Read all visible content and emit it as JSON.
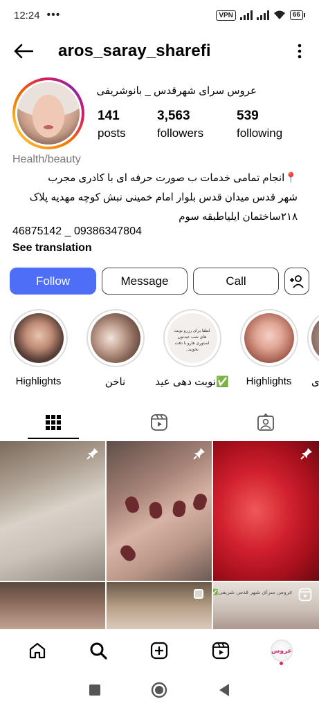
{
  "status_bar": {
    "time": "12:24",
    "vpn": "VPN",
    "battery": "66"
  },
  "header": {
    "username": "aros_saray_sharefi"
  },
  "profile": {
    "full_name": "عروس سرای شهرقدس _ بانوشریفی",
    "stats": [
      {
        "value": "141",
        "label": "posts"
      },
      {
        "value": "3,563",
        "label": "followers"
      },
      {
        "value": "539",
        "label": "following"
      }
    ],
    "category": "Health/beauty",
    "bio_lines": [
      "📍انجام تمامی خدمات ب صورت حرفه ای با کادری مجرب",
      "شهر قدس میدان قدس بلوار امام خمینی نبش کوچه مهدیه پلاک",
      "۲۱۸ساختمان ایلیاطبقه سوم"
    ],
    "phone": "46875142 _ 09386347804",
    "see_translation": "See translation"
  },
  "actions": {
    "follow": "Follow",
    "message": "Message",
    "call": "Call"
  },
  "highlights": [
    {
      "label": "Highlights"
    },
    {
      "label": "ناخن"
    },
    {
      "label": "نوبت دهی عید✅"
    },
    {
      "label": "Highlights"
    },
    {
      "label": "ی"
    }
  ],
  "highlight_card_text": "لطفا برای رزرو نوبت های شب عیدتون استوری هارو با دقت بخونید..",
  "grid_caption": "عروس سرای شهر قدس شریفی✅",
  "nav_avatar_text": "عروس"
}
